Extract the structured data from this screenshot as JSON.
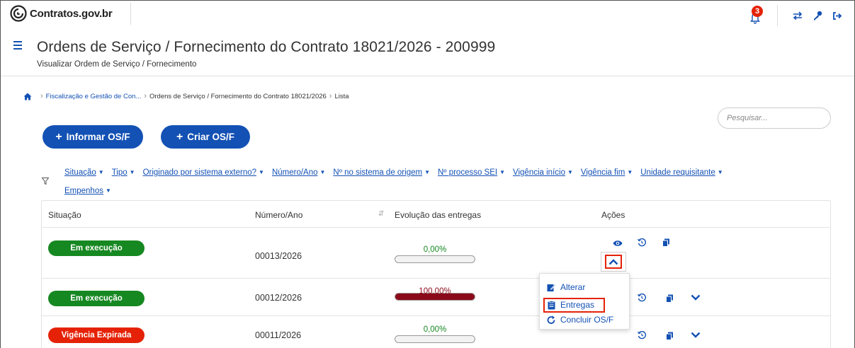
{
  "header": {
    "brand": "Contratos.gov.br",
    "notifications_count": "3",
    "icons": [
      "bell-icon",
      "swap-icon",
      "key-icon",
      "logout-icon"
    ]
  },
  "page": {
    "title": "Ordens de Serviço / Fornecimento do Contrato 18021/2026 - 200999",
    "subtitle": "Visualizar Ordem de Serviço / Fornecimento"
  },
  "breadcrumb": {
    "items": [
      "Fiscalização e Gestão de Con...",
      "Ordens de Serviço / Fornecimento do Contrato 18021/2026",
      "Lista"
    ]
  },
  "search": {
    "placeholder": "Pesquisar..."
  },
  "actions": {
    "informar_label": "Informar OS/F",
    "criar_label": "Criar OS/F"
  },
  "filters": {
    "row1": [
      "Situação",
      "Tipo",
      "Originado por sistema externo?",
      "Número/Ano",
      "Nº no sistema de origem",
      "Nº processo SEI",
      "Vigência início",
      "Vigência fim",
      "Unidade requisitante"
    ],
    "row2": [
      "Empenhos"
    ]
  },
  "table": {
    "columns": [
      "Situação",
      "Número/Ano",
      "Evolução das entregas",
      "Ações"
    ],
    "rows": [
      {
        "status": "Em execução",
        "status_color": "#168821",
        "numero": "00013/2026",
        "progress_label": "0,00%",
        "progress": 0,
        "progress_color": "#168821"
      },
      {
        "status": "Em execução",
        "status_color": "#168821",
        "numero": "00012/2026",
        "progress_label": "100,00%",
        "progress": 1,
        "progress_color": "#8b0a1a"
      },
      {
        "status": "Vigência Expirada",
        "status_color": "#e52207",
        "numero": "00011/2026",
        "progress_label": "0,00%",
        "progress": 0,
        "progress_color": "#168821"
      }
    ]
  },
  "menu": {
    "items": [
      "Alterar",
      "Entregas",
      "Concluir OS/F"
    ]
  },
  "colors": {
    "primary": "#1351b4",
    "success": "#168821",
    "danger": "#e52207",
    "progress_full": "#8b0a1a"
  }
}
